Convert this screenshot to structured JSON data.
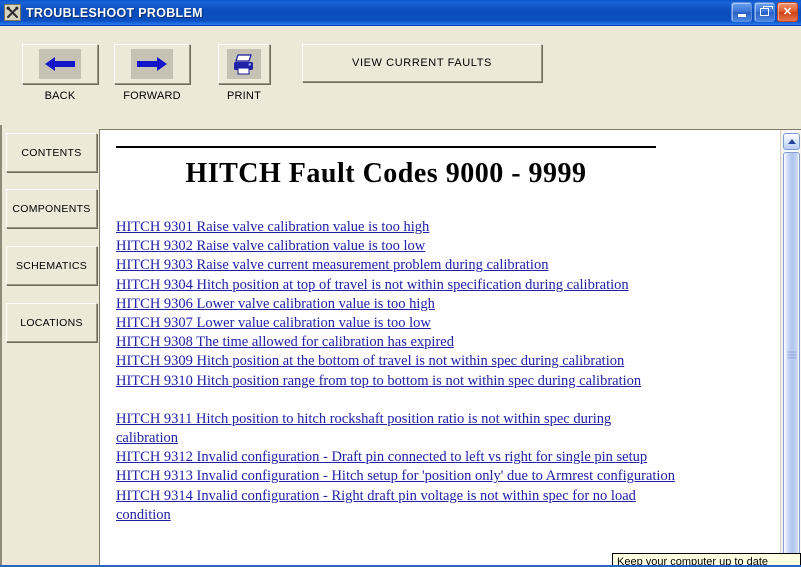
{
  "window": {
    "title": "TROUBLESHOOT PROBLEM",
    "icon": "crossed-tools-icon",
    "controls": {
      "minimize": "Minimize",
      "restore": "Restore",
      "close": "Close"
    },
    "title_bar_color": "#0a4ec0",
    "close_button_color": "#cc4010",
    "chrome_color": "#ece9d8"
  },
  "toolbar": {
    "buttons": [
      {
        "label": "BACK",
        "icon": "arrow-left-icon",
        "icon_color": "#1414c8"
      },
      {
        "label": "FORWARD",
        "icon": "arrow-right-icon",
        "icon_color": "#1414c8"
      },
      {
        "label": "PRINT",
        "icon": "printer-icon",
        "icon_color": "#1a1a9c"
      }
    ],
    "view_current_faults_label": "VIEW CURRENT FAULTS"
  },
  "sidebar": {
    "items": [
      {
        "label": "CONTENTS"
      },
      {
        "label": "COMPONENTS"
      },
      {
        "label": "SCHEMATICS"
      },
      {
        "label": "LOCATIONS"
      }
    ]
  },
  "document": {
    "title": "HITCH Fault Codes 9000 - 9999",
    "links": [
      {
        "text": "HITCH 9301 Raise valve calibration value is too high",
        "spaced": false
      },
      {
        "text": "HITCH 9302 Raise valve calibration value is too low",
        "spaced": false
      },
      {
        "text": "HITCH 9303 Raise valve current measurement problem during calibration",
        "spaced": false
      },
      {
        "text": "HITCH 9304 Hitch position at top of travel is not within specification during calibration",
        "spaced": false
      },
      {
        "text": "HITCH 9306 Lower valve calibration value is too high",
        "spaced": false
      },
      {
        "text": "HITCH 9307 Lower value calibration value is too low",
        "spaced": false
      },
      {
        "text": "HITCH 9308 The time allowed for calibration has expired",
        "spaced": false
      },
      {
        "text": "HITCH 9309 Hitch position at the bottom of travel is not within spec during calibration",
        "spaced": false
      },
      {
        "text": "HITCH 9310 Hitch position range from top to bottom is not within spec during calibration",
        "spaced": false
      },
      {
        "text": "HITCH 9311 Hitch position to hitch rockshaft position ratio is not within spec during calibration",
        "spaced": true
      },
      {
        "text": "HITCH 9312 Invalid configuration - Draft pin connected to left vs right for single pin setup",
        "spaced": false
      },
      {
        "text": "HITCH 9313 Invalid configuration - Hitch setup for 'position only' due to Armrest configuration",
        "spaced": false
      },
      {
        "text": "HITCH 9314 Invalid configuration - Right draft pin voltage is not within spec for no load condition",
        "spaced": false
      }
    ],
    "link_color": "#2020a8"
  },
  "scrollbar": {
    "up_arrow": "scroll-up-arrow-icon"
  },
  "balloon": {
    "text": "Keep your computer up to date"
  }
}
